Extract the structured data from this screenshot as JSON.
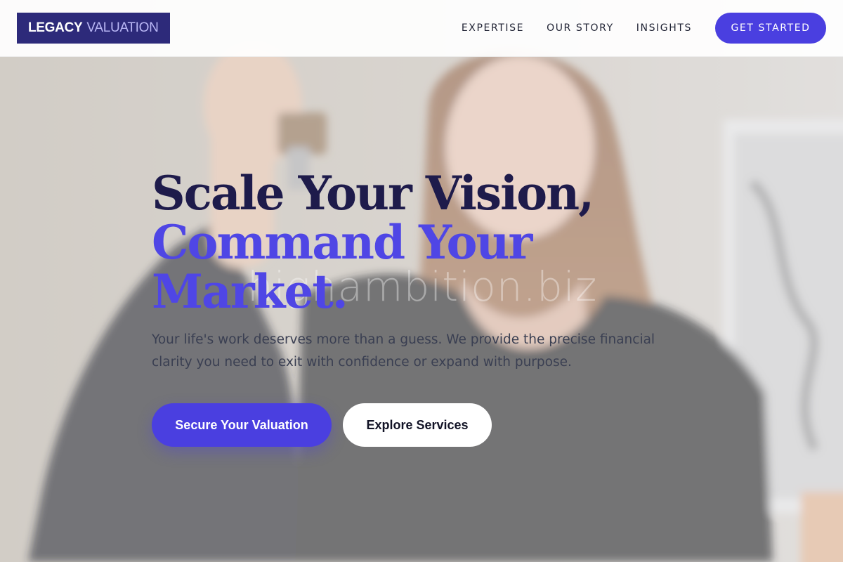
{
  "header": {
    "logo": {
      "part1": "LEGACY",
      "part2": "VALUATION"
    },
    "nav": [
      {
        "label": "EXPERTISE"
      },
      {
        "label": "OUR STORY"
      },
      {
        "label": "INSIGHTS"
      }
    ],
    "cta_label": "GET STARTED"
  },
  "hero": {
    "headline_line1": "Scale Your Vision,",
    "headline_line2": "Command Your",
    "headline_line3": "Market.",
    "subtext": "Your life's work deserves more than a guess. We provide the precise financial clarity you need to exit with confidence or expand with purpose.",
    "primary_button": "Secure Your Valuation",
    "secondary_button": "Explore Services",
    "watermark": "highambition.biz"
  },
  "colors": {
    "brand_dark": "#2d2a7a",
    "accent": "#4f46e5",
    "headline_dark": "#1e1b4b",
    "button": "#4a3fe0"
  },
  "icons": []
}
